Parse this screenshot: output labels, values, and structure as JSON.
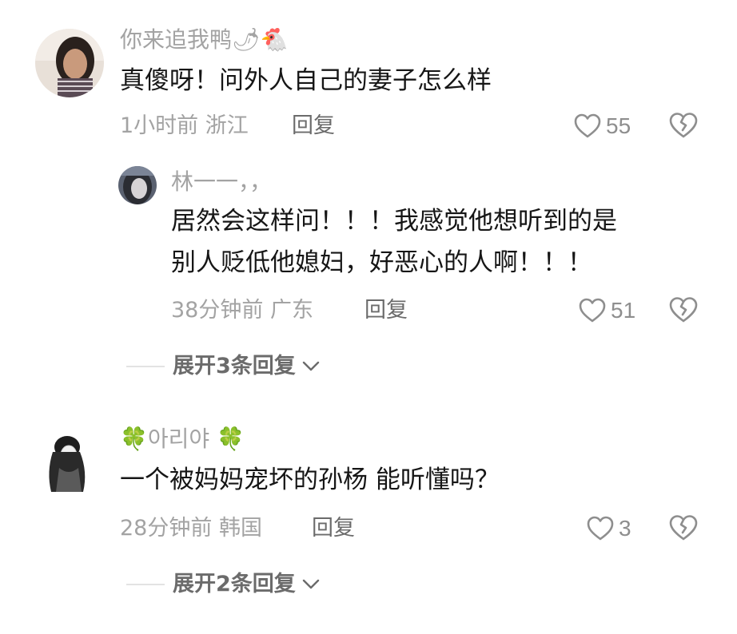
{
  "comments": [
    {
      "username": "你来追我鸭🌶🐔",
      "text": "真傻呀！问外人自己的妻子怎么样",
      "time_location": "1小时前 浙江",
      "reply_label": "回复",
      "likes": "55"
    },
    {
      "username": "林一一，，",
      "text_line1": "居然会这样问！！！我感觉他想听到的是",
      "text_line2": "别人贬低他媳妇，好恶心的人啊！！！",
      "time_location": "38分钟前 广东",
      "reply_label": "回复",
      "likes": "51"
    },
    {
      "expand_label": "展开3条回复"
    },
    {
      "username": "🍀아리야 🍀",
      "text": "一个被妈妈宠坏的孙杨 能听懂吗？",
      "time_location": "28分钟前 韩国",
      "reply_label": "回复",
      "likes": "3"
    },
    {
      "expand_label": "展开2条回复"
    }
  ],
  "colors": {
    "text_primary": "#161616",
    "text_secondary": "#a3a3a3",
    "action": "#6b6b6b"
  },
  "icons": [
    "avatar",
    "heart-outline-icon",
    "broken-heart-icon",
    "chevron-down-icon"
  ]
}
